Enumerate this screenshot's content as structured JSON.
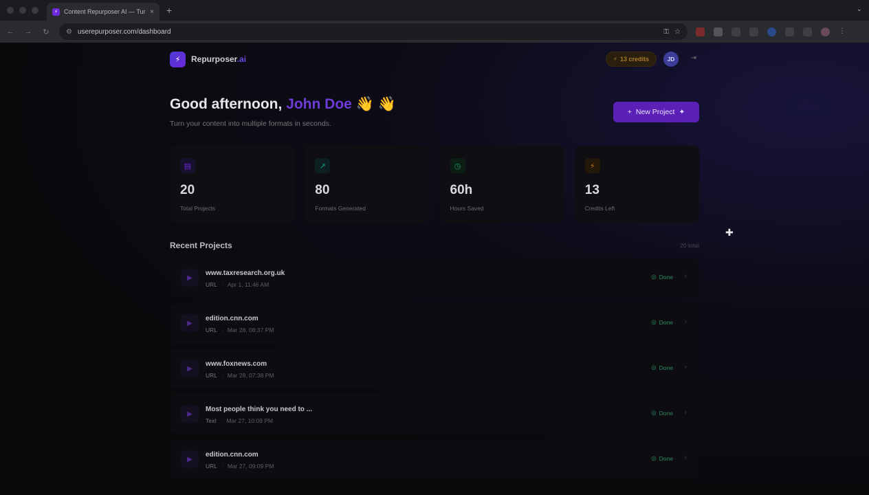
{
  "browser": {
    "tab_title": "Content Repurposer AI — Tur",
    "tab_close": "×",
    "new_tab": "+",
    "url": "userepurposer.com/dashboard"
  },
  "header": {
    "brand_name": "Repurposer",
    "brand_suffix": ".ai",
    "credits_label": "13 credits",
    "avatar_initials": "JD"
  },
  "hero": {
    "greeting_prefix": "Good afternoon, ",
    "user_name": "John Doe",
    "greeting_emoji": " 👋 👋",
    "subtitle": "Turn your content into multiple formats in seconds.",
    "new_project_label": "New Project"
  },
  "stats": [
    {
      "value": "20",
      "label": "Total Projects",
      "icon": "document-icon",
      "color": "#6d28d9"
    },
    {
      "value": "80",
      "label": "Formats Generated",
      "icon": "trending-up-icon",
      "color": "#0f766e"
    },
    {
      "value": "60h",
      "label": "Hours Saved",
      "icon": "clock-icon",
      "color": "#15803d"
    },
    {
      "value": "13",
      "label": "Credits Left",
      "icon": "bolt-icon",
      "color": "#b45309"
    }
  ],
  "recent": {
    "title": "Recent Projects",
    "total": "20 total",
    "items": [
      {
        "title": "www.taxresearch.org.uk",
        "type": "URL",
        "date": "Apr 1, 11:46 AM",
        "status": "Done"
      },
      {
        "title": "edition.cnn.com",
        "type": "URL",
        "date": "Mar 28, 08:37 PM",
        "status": "Done"
      },
      {
        "title": "www.foxnews.com",
        "type": "URL",
        "date": "Mar 28, 07:38 PM",
        "status": "Done"
      },
      {
        "title": "Most people think you need to ...",
        "type": "Text",
        "date": "Mar 27, 10:09 PM",
        "status": "Done"
      },
      {
        "title": "edition.cnn.com",
        "type": "URL",
        "date": "Mar 27, 09:09 PM",
        "status": "Done"
      }
    ]
  }
}
